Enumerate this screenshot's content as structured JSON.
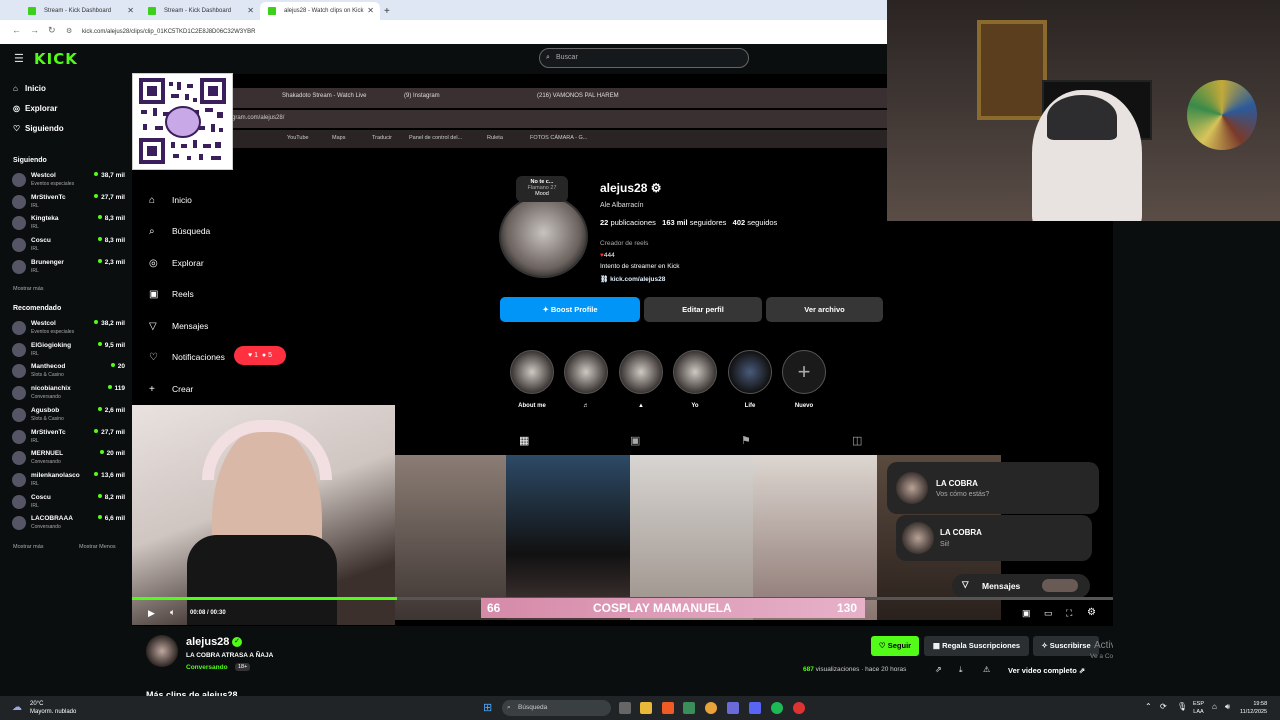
{
  "browser": {
    "tabs": [
      {
        "label": "Stream - Kick Dashboard"
      },
      {
        "label": "Stream - Kick Dashboard"
      },
      {
        "label": "alejus28 - Watch clips on Kick"
      }
    ],
    "url": "kick.com/alejus28/clips/clip_01KC5TKD1C2E8J8D06C32W3YBR"
  },
  "kick": {
    "search_placeholder": "Buscar",
    "nav": [
      "Inicio",
      "Explorar",
      "Siguiendo"
    ],
    "following_title": "Siguiendo",
    "following": [
      {
        "name": "Westcol",
        "cat": "Eventos especiales",
        "viewers": "38,7 mil"
      },
      {
        "name": "MrStivenTc",
        "cat": "IRL",
        "viewers": "27,7 mil"
      },
      {
        "name": "Kingteka",
        "cat": "IRL",
        "viewers": "8,3 mil"
      },
      {
        "name": "Coscu",
        "cat": "IRL",
        "viewers": "8,3 mil"
      },
      {
        "name": "Brunenger",
        "cat": "IRL",
        "viewers": "2,3 mil"
      }
    ],
    "show_more": "Mostrar más",
    "recommended_title": "Recomendado",
    "recommended": [
      {
        "name": "Westcol",
        "cat": "Eventos especiales",
        "viewers": "38,2 mil"
      },
      {
        "name": "ElGiogioking",
        "cat": "IRL",
        "viewers": "9,5 mil"
      },
      {
        "name": "Manthecod",
        "cat": "Slots & Casino",
        "viewers": "20"
      },
      {
        "name": "nicobianchix",
        "cat": "Conversando",
        "viewers": "119"
      },
      {
        "name": "Agusbob",
        "cat": "Slots & Casino",
        "viewers": "2,6 mil"
      },
      {
        "name": "MrStivenTc",
        "cat": "IRL",
        "viewers": "27,7 mil"
      },
      {
        "name": "MERNUEL",
        "cat": "Conversando",
        "viewers": "20 mil"
      },
      {
        "name": "milenkanolasco",
        "cat": "IRL",
        "viewers": "13,6 mil"
      },
      {
        "name": "Coscu",
        "cat": "IRL",
        "viewers": "8,2 mil"
      },
      {
        "name": "LACOBRAAA",
        "cat": "Conversando",
        "viewers": "6,6 mil"
      }
    ],
    "show_more2": "Mostrar más",
    "show_less": "Mostrar Menos"
  },
  "instagram": {
    "tabs": [
      "Shakadoto Stream - Watch Live",
      "(9) Instagram",
      "(216) VAMONOS PAL HAREM"
    ],
    "address": "gram.com/alejus28/",
    "bookmarks": [
      "YouTube",
      "Maps",
      "Traducir",
      "Panel de control del...",
      "Ruleta",
      "FOTOS CÁMARA - G..."
    ],
    "nav": [
      "Inicio",
      "Búsqueda",
      "Explorar",
      "Reels",
      "Mensajes",
      "Notificaciones",
      "Crear"
    ],
    "notif_likes": "1",
    "notif_follows": "5",
    "note": [
      "No te c...",
      "Flamano 27",
      "Mood"
    ],
    "username": "alejus28",
    "fullname": "Ale Albarracín",
    "posts": "22",
    "posts_label": "publicaciones",
    "followers": "163 mil",
    "followers_label": "seguidores",
    "following": "402",
    "following_label": "seguidos",
    "bio_category": "Creador de reels",
    "bio_line1": "444",
    "bio_line2": "Intento de streamer en Kick",
    "bio_link": "kick.com/alejus28",
    "btn_boost": "Boost Profile",
    "btn_edit": "Editar perfil",
    "btn_archive": "Ver archivo",
    "highlights": [
      "About me",
      "",
      "",
      "Yo",
      "Life",
      "Nuevo"
    ],
    "chat1_name": "LA COBRA",
    "chat1_msg": "Vos cómo estás?",
    "chat2_name": "LA COBRA",
    "chat2_msg": "Sii!",
    "messages_label": "Mensajes"
  },
  "player": {
    "time": "00:08 / 00:30",
    "banner_left": "66",
    "banner_text": "COSPLAY MAMANUELA",
    "banner_right": "130",
    "progress_fraction": 0.27
  },
  "channel": {
    "name": "alejus28",
    "title": "LA COBRA ATRASA A ÑAJA",
    "category": "Conversando",
    "age": "18+",
    "follow": "Seguir",
    "gift": "Regala Suscripciones",
    "subscribe": "Suscribirse",
    "views": "687",
    "views_label": "visualizaciones",
    "ago": "· hace 20 horas",
    "full_video": "Ver video completo",
    "more_clips": "Más clips de alejus28"
  },
  "windows": {
    "activate_title": "Activar Windows",
    "activate_sub": "Ve a Configuración para activar Windows.",
    "temp": "20°C",
    "weather": "Mayorm. nublado",
    "search": "Búsqueda",
    "lang1": "ESP",
    "lang2": "LAA",
    "time": "19:58",
    "date": "11/12/2025"
  },
  "colors": {
    "kick_green": "#53fc18",
    "ig_blue": "#0095f6",
    "notif_red": "#ff3040"
  }
}
